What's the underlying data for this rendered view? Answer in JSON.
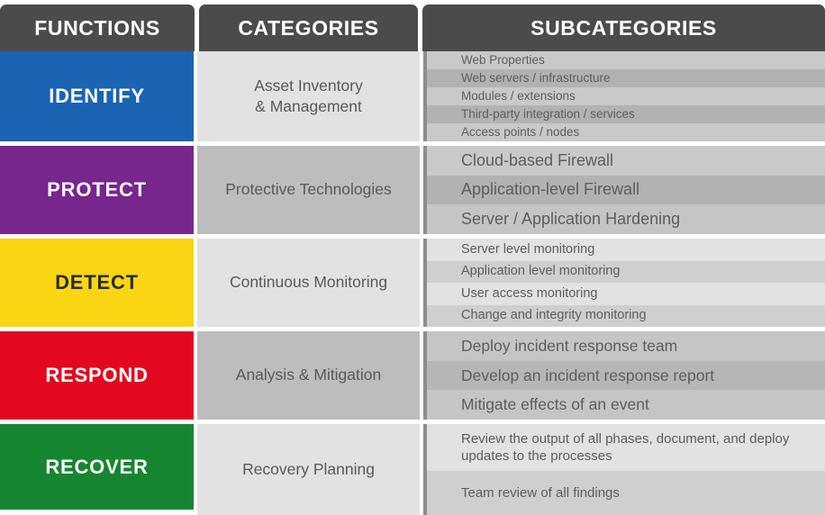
{
  "header": {
    "functions": "FUNCTIONS",
    "categories": "CATEGORIES",
    "subcategories": "SUBCATEGORIES"
  },
  "colors": {
    "header_bg": "#4b4b4b",
    "identify": "#1b63b3",
    "protect": "#76268c",
    "detect": "#fad513",
    "respond": "#e3081d",
    "recover": "#15862f",
    "divider": "#8d8d8d"
  },
  "rows": [
    {
      "function": "IDENTIFY",
      "function_color": "#1b63b3",
      "function_text_color": "#ffffff",
      "category": "Asset Inventory\n& Management",
      "category_line1": "Asset Inventory",
      "category_line2": "& Management",
      "subcategories": [
        "Web Properties",
        "Web servers / infrastructure",
        "Modules / extensions",
        "Third-party integration / services",
        "Access points / nodes"
      ]
    },
    {
      "function": "PROTECT",
      "function_color": "#76268c",
      "function_text_color": "#ffffff",
      "category": "Protective Technologies",
      "category_line1": "Protective Technologies",
      "category_line2": "",
      "subcategories": [
        "Cloud-based Firewall",
        "Application-level Firewall",
        "Server / Application Hardening"
      ]
    },
    {
      "function": "DETECT",
      "function_color": "#fad513",
      "function_text_color": "#2b2b2b",
      "category": "Continuous Monitoring",
      "category_line1": "Continuous Monitoring",
      "category_line2": "",
      "subcategories": [
        "Server level monitoring",
        "Application level monitoring",
        "User access monitoring",
        "Change and integrity monitoring"
      ]
    },
    {
      "function": "RESPOND",
      "function_color": "#e3081d",
      "function_text_color": "#ffffff",
      "category": "Analysis & Mitigation",
      "category_line1": "Analysis & Mitigation",
      "category_line2": "",
      "subcategories": [
        "Deploy incident response team",
        "Develop an incident response report",
        "Mitigate effects of an event"
      ]
    },
    {
      "function": "RECOVER",
      "function_color": "#15862f",
      "function_text_color": "#ffffff",
      "category": "Recovery Planning",
      "category_line1": "Recovery Planning",
      "category_line2": "",
      "subcategories": [
        "Review the output of all phases, document, and deploy updates to the processes",
        "Team review of all findings"
      ]
    }
  ]
}
